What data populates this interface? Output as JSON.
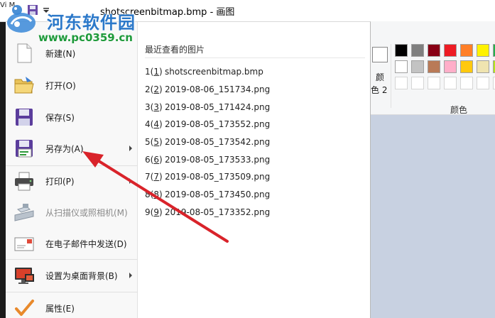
{
  "window": {
    "title": "shotscreenbitmap.bmp",
    "app_name": "画图",
    "left_edge_text": "Vi M"
  },
  "watermark": {
    "site_name": "河东软件园",
    "url": "www.pc0359.cn"
  },
  "menu": {
    "items": [
      {
        "label": "新建(N)",
        "icon": "new-file-icon"
      },
      {
        "label": "打开(O)",
        "icon": "open-folder-icon"
      },
      {
        "label": "保存(S)",
        "icon": "save-floppy-icon"
      },
      {
        "label": "另存为(A)",
        "icon": "save-as-icon",
        "submenu": true
      },
      {
        "label": "打印(P)",
        "icon": "printer-icon",
        "submenu": true
      },
      {
        "label": "从扫描仪或照相机(M)",
        "icon": "scanner-icon",
        "disabled": true
      },
      {
        "label": "在电子邮件中发送(D)",
        "icon": "email-icon"
      },
      {
        "label": "设置为桌面背景(B)",
        "icon": "desktop-background-icon",
        "submenu": true
      },
      {
        "label": "属性(E)",
        "icon": "properties-check-icon"
      }
    ]
  },
  "recent": {
    "heading": "最近查看的图片",
    "items": [
      {
        "num": "1",
        "key": "1",
        "name": "shotscreenbitmap.bmp"
      },
      {
        "num": "2",
        "key": "2",
        "name": "2019-08-06_151734.png"
      },
      {
        "num": "3",
        "key": "3",
        "name": "2019-08-05_171424.png"
      },
      {
        "num": "4",
        "key": "4",
        "name": "2019-08-05_173552.png"
      },
      {
        "num": "5",
        "key": "5",
        "name": "2019-08-05_173542.png"
      },
      {
        "num": "6",
        "key": "6",
        "name": "2019-08-05_173533.png"
      },
      {
        "num": "7",
        "key": "7",
        "name": "2019-08-05_173509.png"
      },
      {
        "num": "8",
        "key": "8",
        "name": "2019-08-05_173450.png"
      },
      {
        "num": "9",
        "key": "9",
        "name": "2019-08-05_173352.png"
      }
    ]
  },
  "ribbon": {
    "color2_label_a": "颜",
    "color2_label_b": "色 2",
    "colors_group_label": "颜色",
    "palette": [
      "#000000",
      "#7f7f7f",
      "#880015",
      "#ed1c24",
      "#ff7f27",
      "#fff200",
      "#22b14c",
      "#ffffff",
      "#c3c3c3",
      "#b97a57",
      "#ffaec9",
      "#ffc90e",
      "#efe4b0",
      "#b5e61d",
      "",
      "",
      "",
      "",
      "",
      "",
      ""
    ]
  },
  "colors": {
    "arrow_red": "#d9232a",
    "menu_edge": "#1b1b1b"
  }
}
